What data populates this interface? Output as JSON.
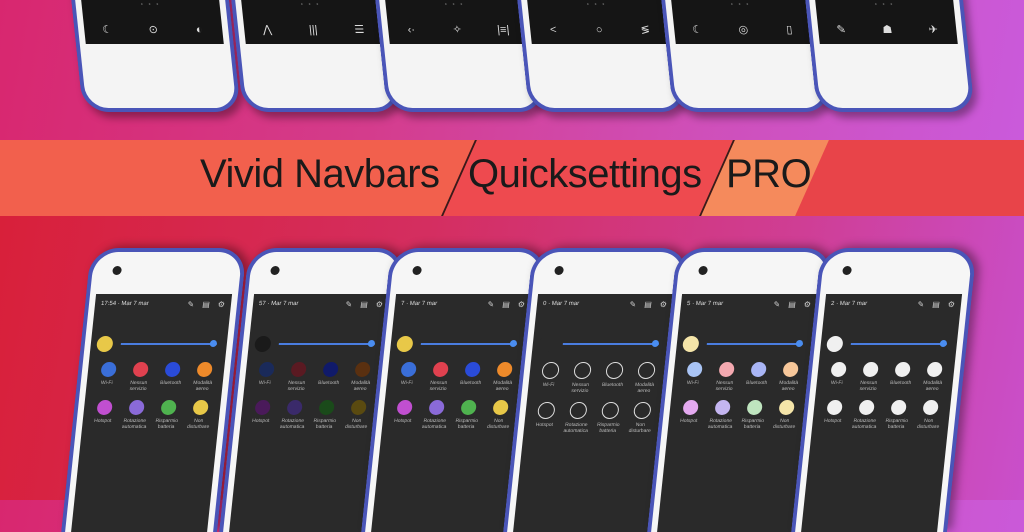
{
  "banner": {
    "part1": "Vivid Navbars",
    "part2": "Quicksettings",
    "part3": "PRO"
  },
  "top_phones": [
    {
      "icons": [
        "☾",
        "⊙",
        "◐"
      ],
      "dots": "• • •"
    },
    {
      "icons": [
        "⋀",
        "|||",
        "☰"
      ],
      "dots": "• • •"
    },
    {
      "icons": [
        "‹·",
        "✧",
        "|≡|"
      ],
      "dots": "• • •"
    },
    {
      "icons": [
        "<",
        "○",
        "≶"
      ],
      "dots": "• • •"
    },
    {
      "icons": [
        "☾",
        "◎",
        "▯"
      ],
      "dots": "• • •"
    },
    {
      "icons": [
        "✎",
        "☗",
        "✈"
      ],
      "dots": "• • •"
    }
  ],
  "quicksettings": {
    "time": "17:54",
    "date": "Mar 7 mar",
    "labels": [
      "Wi-Fi",
      "Nessun servizio",
      "Bluetooth",
      "Modalità aereo",
      "Hotspot",
      "Rotazione automatica",
      "Risparmio batteria",
      "Non disturbare"
    ],
    "phones": [
      {
        "status": "17:54 · Mar 7 mar",
        "colors": [
          "#3a6ed8",
          "#e0414f",
          "#2a4bd8",
          "#ee8a2a",
          "#c04fd0",
          "#8a6ad8",
          "#4fb34f",
          "#e8c848"
        ],
        "sun": "#e8c848"
      },
      {
        "status": "57 · Mar 7 mar",
        "colors": [
          "#1a2a5a",
          "#5a1a22",
          "#101a6a",
          "#5a3010",
          "#4a1a5a",
          "#3a2a6a",
          "#1a4a1a",
          "#5a4a10"
        ],
        "sun": "#1a1a1a"
      },
      {
        "status": "7 · Mar 7 mar",
        "colors": [
          "#3a6ed8",
          "#e0414f",
          "#2a4bd8",
          "#ee8a2a",
          "#c04fd0",
          "#8a6ad8",
          "#4fb34f",
          "#e8c848"
        ],
        "sun": "#e8c848"
      },
      {
        "status": "0 · Mar 7 mar",
        "colors": [
          "#2a2a2a",
          "#2a2a2a",
          "#2a2a2a",
          "#2a2a2a",
          "#2a2a2a",
          "#2a2a2a",
          "#2a2a2a",
          "#2a2a2a"
        ],
        "sun": "#2a2a2a"
      },
      {
        "status": "5 · Mar 7 mar",
        "colors": [
          "#a9c4f5",
          "#f4a9b0",
          "#a9b5f5",
          "#f7c79a",
          "#e3a9ef",
          "#c4b5f0",
          "#bfe5bf",
          "#f5e5a9"
        ],
        "sun": "#f5e5a9"
      },
      {
        "status": "2 · Mar 7 mar",
        "colors": [
          "#f0f0f0",
          "#f0f0f0",
          "#f0f0f0",
          "#f0f0f0",
          "#f0f0f0",
          "#f0f0f0",
          "#f0f0f0",
          "#f0f0f0"
        ],
        "sun": "#f0f0f0"
      }
    ]
  }
}
